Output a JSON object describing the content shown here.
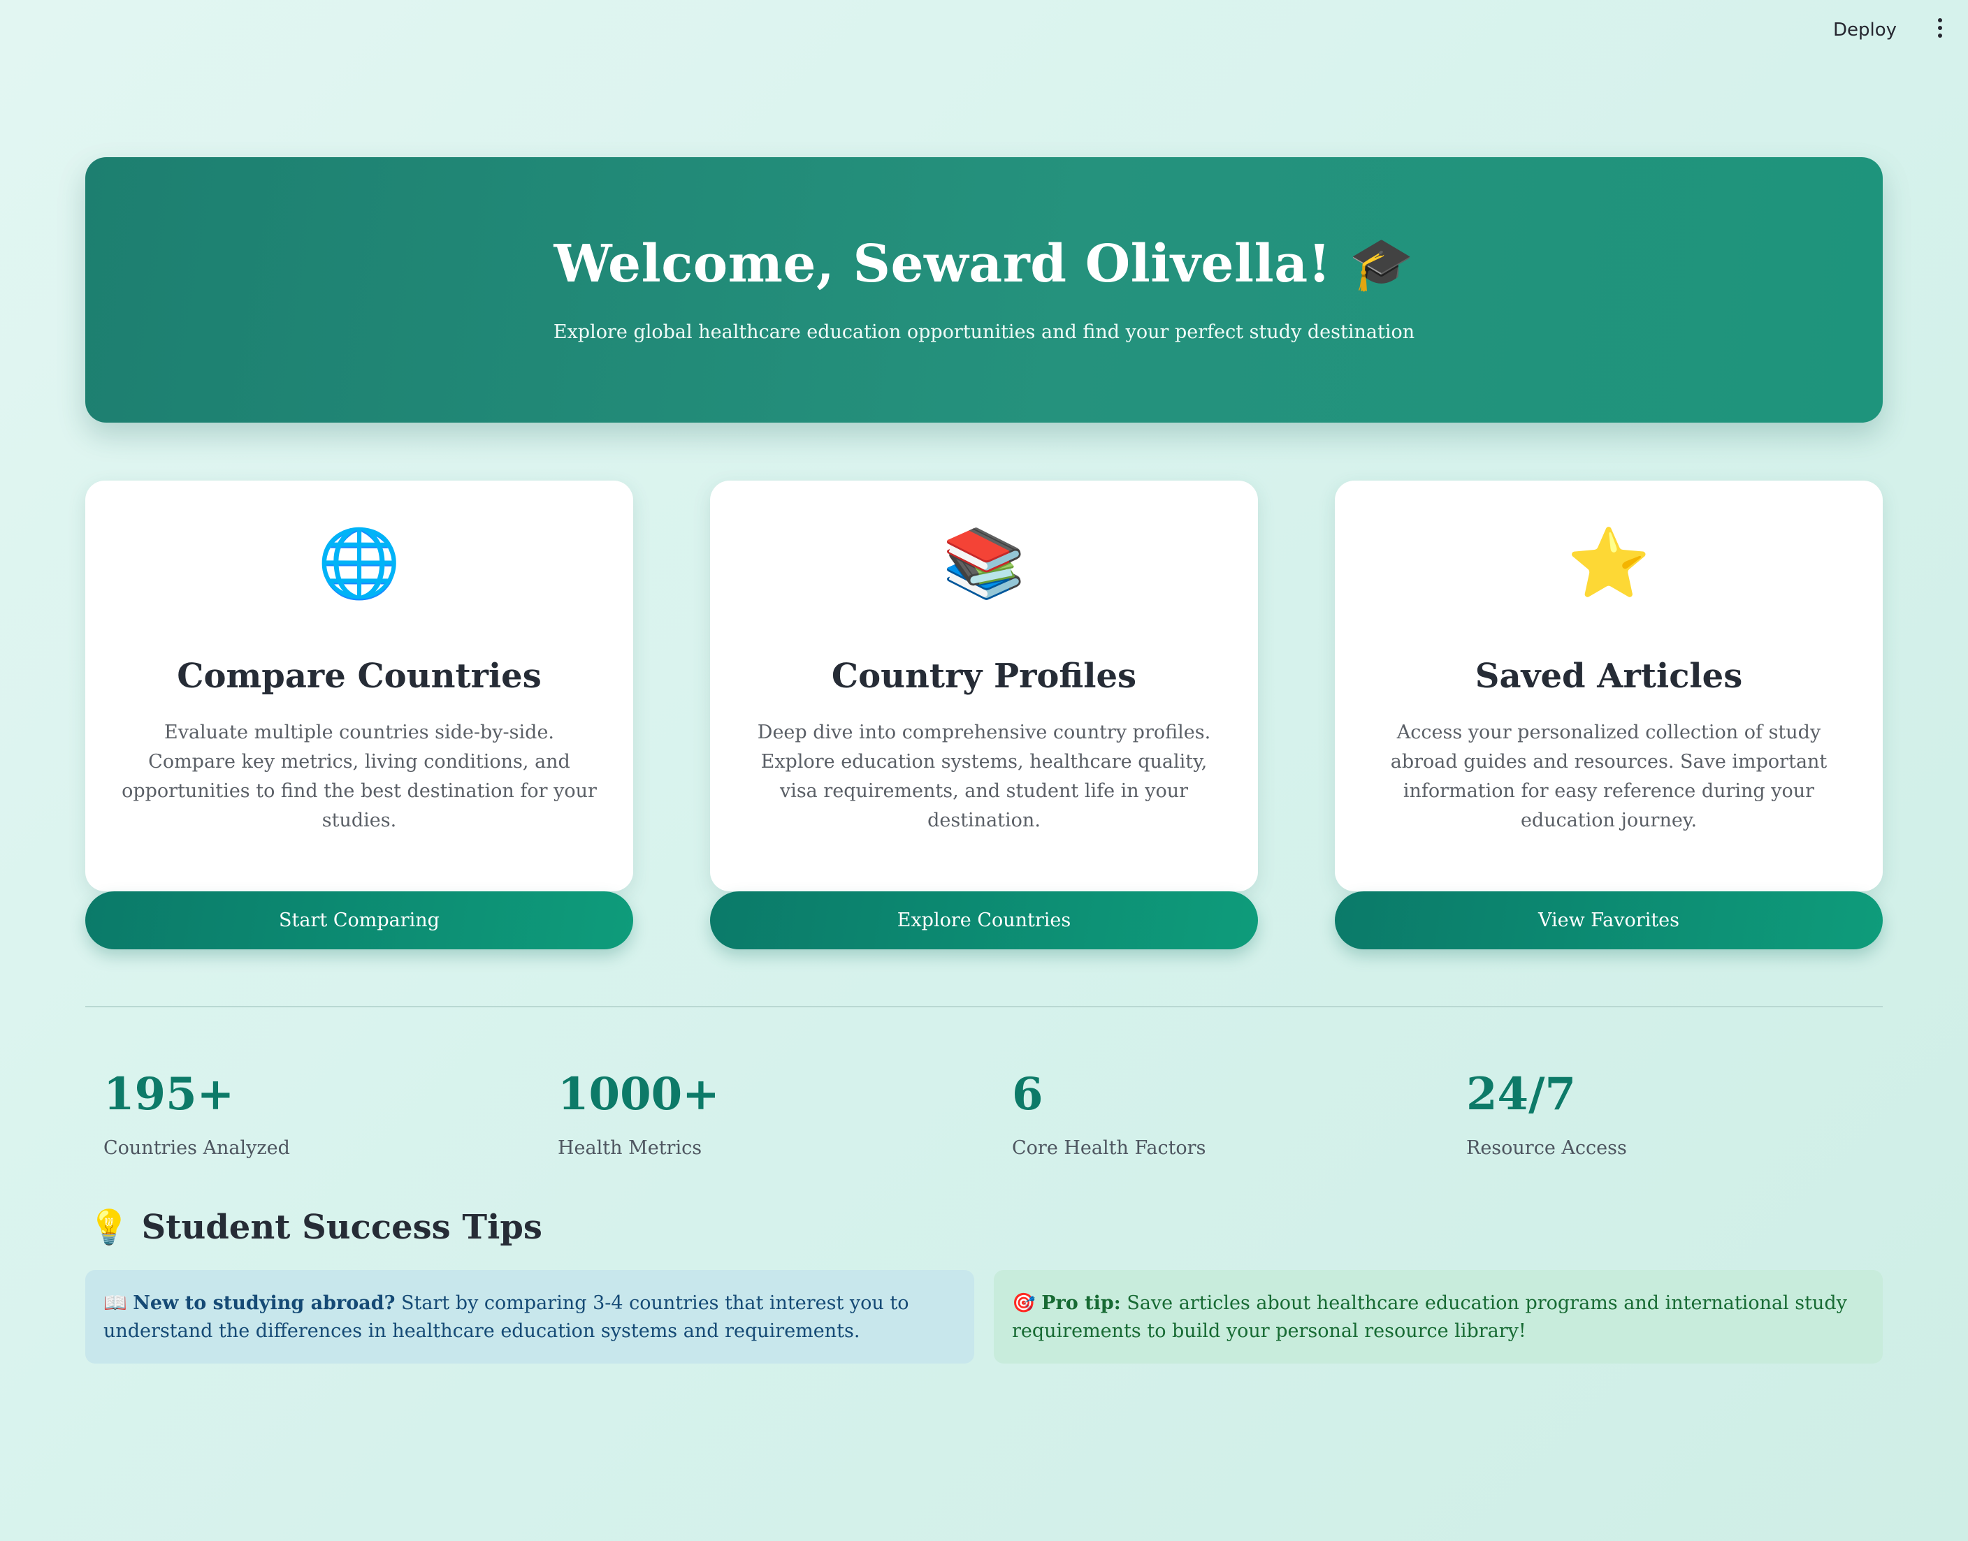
{
  "topbar": {
    "deploy_label": "Deploy",
    "menu_icon": "more-vertical-icon"
  },
  "hero": {
    "title": "Welcome, Seward Olivella! 🎓",
    "subtitle": "Explore global healthcare education opportunities and find your perfect study destination"
  },
  "cards": [
    {
      "icon": "🌐",
      "icon_name": "globe-icon",
      "title": "Compare Countries",
      "description": "Evaluate multiple countries side-by-side. Compare key metrics, living conditions, and opportunities to find the best destination for your studies.",
      "button_label": "Start Comparing"
    },
    {
      "icon": "📚",
      "icon_name": "books-icon",
      "title": "Country Profiles",
      "description": "Deep dive into comprehensive country profiles. Explore education systems, healthcare quality, visa requirements, and student life in your destination.",
      "button_label": "Explore Countries"
    },
    {
      "icon": "⭐",
      "icon_name": "star-icon",
      "title": "Saved Articles",
      "description": "Access your personalized collection of study abroad guides and resources. Save important information for easy reference during your education journey.",
      "button_label": "View Favorites"
    }
  ],
  "stats": [
    {
      "value": "195+",
      "label": "Countries Analyzed"
    },
    {
      "value": "1000+",
      "label": "Health Metrics"
    },
    {
      "value": "6",
      "label": "Core Health Factors"
    },
    {
      "value": "24/7",
      "label": "Resource Access"
    }
  ],
  "tips": {
    "heading": "💡 Student Success Tips",
    "info": {
      "icon": "📖",
      "bold": "New to studying abroad?",
      "text": " Start by comparing 3-4 countries that interest you to understand the differences in healthcare education systems and requirements."
    },
    "success": {
      "icon": "🎯",
      "bold": "Pro tip:",
      "text": " Save articles about healthcare education programs and international study requirements to build your personal resource library!"
    }
  },
  "colors": {
    "accent": "#0d7a68",
    "hero_gradient_start": "#1d7f70",
    "hero_gradient_end": "#1e947c",
    "info_bg": "#c8e7ec",
    "success_bg": "#c8ecdc"
  }
}
